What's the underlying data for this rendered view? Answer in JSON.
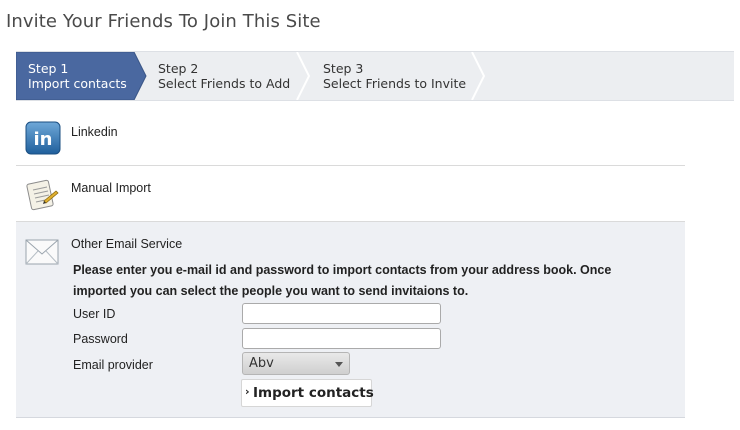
{
  "page": {
    "title": "Invite Your Friends To Join This Site"
  },
  "wizard": {
    "steps": [
      {
        "number": "Step 1",
        "label": "Import contacts",
        "active": true
      },
      {
        "number": "Step 2",
        "label": "Select Friends to Add",
        "active": false
      },
      {
        "number": "Step 3",
        "label": "Select Friends to Invite",
        "active": false
      }
    ],
    "colors": {
      "active": "#4a68a0",
      "inactive": "#eceef1"
    }
  },
  "sources": {
    "linkedin": {
      "label": "Linkedin",
      "icon": "linkedin-icon"
    },
    "manual": {
      "label": "Manual Import",
      "icon": "notepad-icon"
    },
    "other": {
      "label": "Other Email Service",
      "icon": "envelope-icon",
      "instructions": "Please enter you e-mail id and password to import contacts from your address book. Once imported you can select the people you want to send invitaions to.",
      "fields": {
        "user_id": {
          "label": "User ID",
          "value": ""
        },
        "password": {
          "label": "Password",
          "value": ""
        },
        "provider": {
          "label": "Email provider",
          "value": "Abv"
        }
      },
      "import_button": "Import contacts"
    }
  }
}
